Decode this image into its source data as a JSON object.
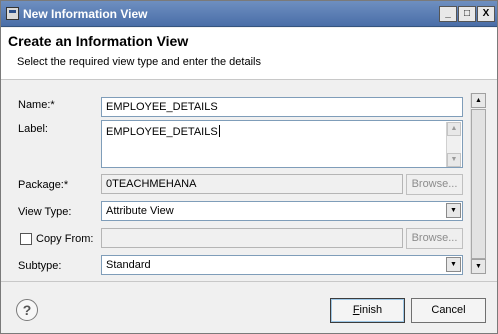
{
  "window": {
    "title": "New Information View",
    "controls": {
      "minimize": "_",
      "maximize": "□",
      "close": "X"
    }
  },
  "header": {
    "title": "Create an Information View",
    "subtitle": "Select the required view type and enter the details"
  },
  "form": {
    "name_label": "Name:*",
    "name_value": "EMPLOYEE_DETAILS",
    "label_label": "Label:",
    "label_value": "EMPLOYEE_DETAILS",
    "package_label": "Package:*",
    "package_value": "0TEACHMEHANA",
    "package_browse": "Browse...",
    "viewtype_label": "View Type:",
    "viewtype_value": "Attribute View",
    "copyfrom_label": "Copy From:",
    "copyfrom_value": "",
    "copyfrom_checked": false,
    "copyfrom_browse": "Browse...",
    "subtype_label": "Subtype:",
    "subtype_value": "Standard"
  },
  "footer": {
    "help": "?",
    "finish_first": "F",
    "finish_rest": "inish",
    "cancel": "Cancel"
  }
}
